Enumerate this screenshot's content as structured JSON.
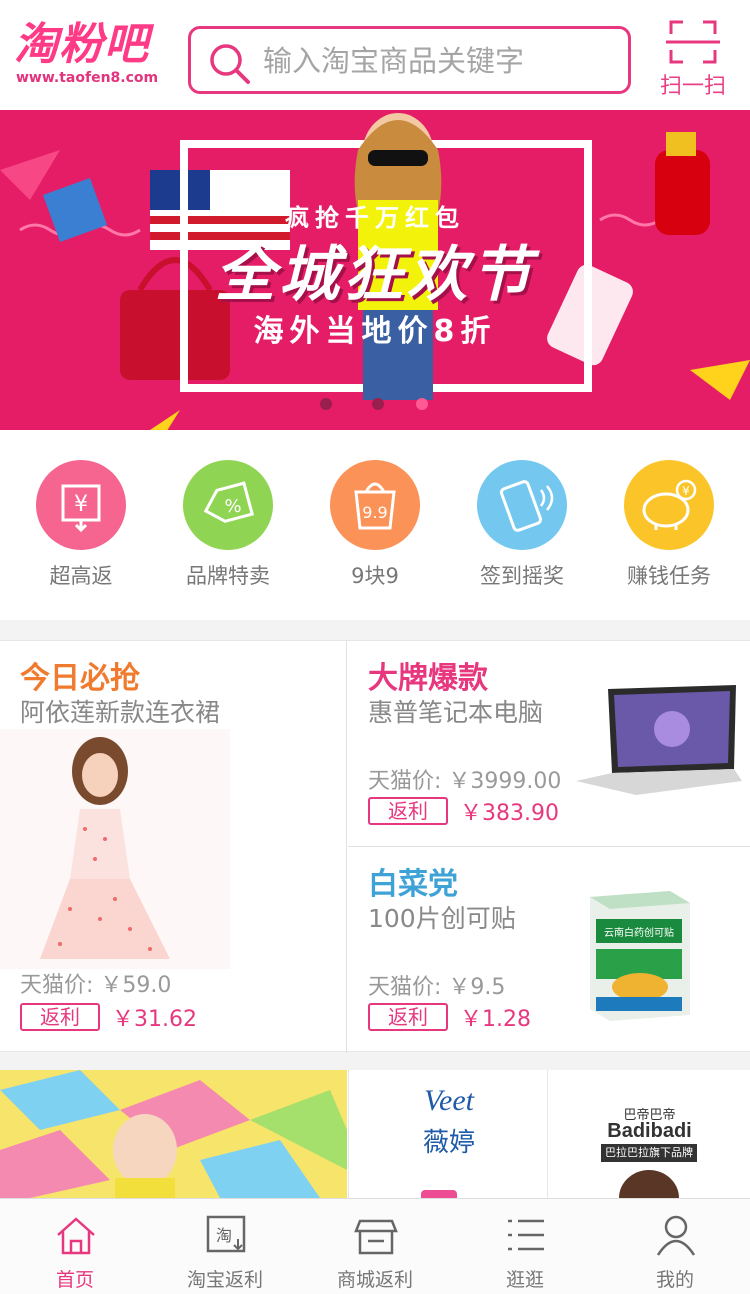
{
  "header": {
    "logo_text": "淘粉吧",
    "logo_url": "www.taofen8.com",
    "search_placeholder": "输入淘宝商品关键字",
    "scan_label": "扫一扫",
    "accent_color": "#e7387f"
  },
  "banner": {
    "line1": "疯抢千万红包",
    "line2": "全城狂欢节",
    "line3": "海外当地价8折",
    "background_color": "#e51d66",
    "slide_count": 3,
    "active_slide": 2
  },
  "categories": [
    {
      "label": "超高返",
      "icon": "rebate-yen-icon",
      "color": "#f5658f"
    },
    {
      "label": "品牌特卖",
      "icon": "discount-tag-icon",
      "color": "#8fd553"
    },
    {
      "label": "9块9",
      "icon": "shopping-bag-99-icon",
      "color": "#fb9257"
    },
    {
      "label": "签到摇奖",
      "icon": "phone-shake-icon",
      "color": "#74c8ef"
    },
    {
      "label": "赚钱任务",
      "icon": "piggy-bank-icon",
      "color": "#fbc52a"
    }
  ],
  "promo": {
    "today": {
      "title": "今日必抢",
      "subtitle": "阿依莲新款连衣裙",
      "price_label": "天猫价: ￥59.0",
      "rebate_tag": "返利",
      "rebate_value": "￥31.62",
      "title_color": "#f07b2f"
    },
    "brand": {
      "title": "大牌爆款",
      "subtitle": "惠普笔记本电脑",
      "price_label": "天猫价: ￥3999.00",
      "rebate_tag": "返利",
      "rebate_value": "￥383.90",
      "title_color": "#e7387f"
    },
    "cabbage": {
      "title": "白菜党",
      "subtitle": "100片创可贴",
      "price_label": "天猫价: ￥9.5",
      "rebate_tag": "返利",
      "rebate_value": "￥1.28",
      "title_color": "#3fa2d6"
    }
  },
  "brands": {
    "veet_logo": "Veet",
    "veet_cn": "薇婷",
    "badi_cn": "巴帝巴帝",
    "badi_logo": "Badibadi",
    "badi_tagline": "巴拉巴拉旗下品牌"
  },
  "product_labels": {
    "bandage_box": "云南白药创可贴"
  },
  "tabbar": [
    {
      "label": "首页",
      "icon": "home-icon",
      "active": true
    },
    {
      "label": "淘宝返利",
      "icon": "taobao-rebate-icon",
      "active": false
    },
    {
      "label": "商城返利",
      "icon": "store-icon",
      "active": false
    },
    {
      "label": "逛逛",
      "icon": "list-icon",
      "active": false
    },
    {
      "label": "我的",
      "icon": "user-icon",
      "active": false
    }
  ]
}
